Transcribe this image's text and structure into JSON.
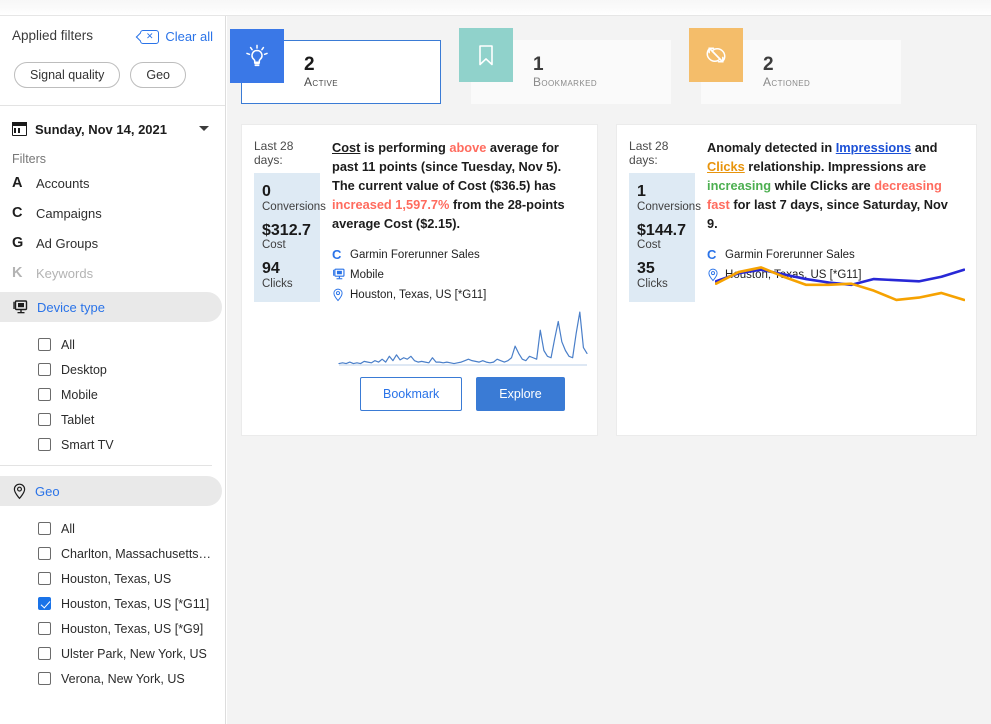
{
  "sidebar": {
    "title": "Applied filters",
    "clear_all": "Clear all",
    "clear_icon": "clear-x-icon",
    "chips": [
      {
        "label": "Signal quality"
      },
      {
        "label": "Geo"
      }
    ],
    "date": {
      "icon": "calendar-icon",
      "value": "Sunday, Nov 14, 2021",
      "caret": "chevron-down-icon"
    },
    "filters_label": "Filters",
    "filters": [
      {
        "letter": "A",
        "label": "Accounts",
        "dim": false
      },
      {
        "letter": "C",
        "label": "Campaigns",
        "dim": false
      },
      {
        "letter": "G",
        "label": "Ad Groups",
        "dim": false
      },
      {
        "letter": "K",
        "label": "Keywords",
        "dim": true
      }
    ],
    "sections": [
      {
        "id": "device-type",
        "icon": "device-monitor-icon",
        "label": "Device type",
        "options": [
          {
            "label": "All",
            "checked": false
          },
          {
            "label": "Desktop",
            "checked": false
          },
          {
            "label": "Mobile",
            "checked": false
          },
          {
            "label": "Tablet",
            "checked": false
          },
          {
            "label": "Smart TV",
            "checked": false
          }
        ]
      },
      {
        "id": "geo",
        "icon": "location-pin-icon",
        "label": "Geo",
        "options": [
          {
            "label": "All",
            "checked": false
          },
          {
            "label": "Charlton, Massachusetts…",
            "checked": false
          },
          {
            "label": "Houston, Texas, US",
            "checked": false
          },
          {
            "label": "Houston, Texas, US [*G11]",
            "checked": true
          },
          {
            "label": "Houston, Texas, US [*G9]",
            "checked": false
          },
          {
            "label": "Ulster Park, New York, US",
            "checked": false
          },
          {
            "label": "Verona, New York, US",
            "checked": false
          }
        ]
      }
    ]
  },
  "status_cards": [
    {
      "id": "active",
      "count": "2",
      "label": "Active",
      "icon": "lightbulb-icon",
      "selected": true,
      "color": "#3a78e7"
    },
    {
      "id": "bookmarked",
      "count": "1",
      "label": "Bookmarked",
      "icon": "bookmark-icon",
      "selected": false,
      "color": "#90d2cb"
    },
    {
      "id": "actioned",
      "count": "2",
      "label": "Actioned",
      "icon": "actioned-arrows-icon",
      "selected": false,
      "color": "#f4bd6a"
    }
  ],
  "insight_cards": [
    {
      "id": "cost-insight",
      "period_label": "Last 28 days:",
      "metrics": [
        {
          "value": "0",
          "label": "Conversions"
        },
        {
          "value": "$312.7",
          "label": "Cost"
        },
        {
          "value": "94",
          "label": "Clicks"
        }
      ],
      "narrative": {
        "segments": [
          {
            "text": "Cost",
            "style": "underline"
          },
          {
            "text": " is performing ",
            "style": "plain"
          },
          {
            "text": "above",
            "style": "red"
          },
          {
            "text": " average for past 11 points (since Tuesday, Nov 5). The current value of Cost ($36.5) has ",
            "style": "plain"
          },
          {
            "text": "increased 1,597.7%",
            "style": "red"
          },
          {
            "text": " from the 28-points average Cost ($2.15).",
            "style": "plain"
          }
        ]
      },
      "meta": [
        {
          "icon": "campaign-c-icon",
          "text": "Garmin Forerunner Sales"
        },
        {
          "icon": "device-monitor-icon",
          "text": "Mobile"
        },
        {
          "icon": "location-pin-icon",
          "text": "Houston, Texas, US [*G11]"
        }
      ],
      "buttons": [
        {
          "id": "bookmark",
          "label": "Bookmark",
          "variant": "ghost"
        },
        {
          "id": "explore",
          "label": "Explore",
          "variant": "primary"
        }
      ]
    },
    {
      "id": "anomaly-insight",
      "period_label": "Last 28 days:",
      "metrics": [
        {
          "value": "1",
          "label": "Conversions"
        },
        {
          "value": "$144.7",
          "label": "Cost"
        },
        {
          "value": "35",
          "label": "Clicks"
        }
      ],
      "narrative": {
        "segments": [
          {
            "text": "Anomaly detected in ",
            "style": "plain"
          },
          {
            "text": "Impressions",
            "style": "blue-underline"
          },
          {
            "text": " and ",
            "style": "plain"
          },
          {
            "text": "Clicks",
            "style": "orange-underline"
          },
          {
            "text": " relationship. Impressions are ",
            "style": "plain"
          },
          {
            "text": "increasing",
            "style": "green"
          },
          {
            "text": " while Clicks are ",
            "style": "plain"
          },
          {
            "text": "decreasing fast",
            "style": "red"
          },
          {
            "text": " for last 7 days, since Saturday, Nov 9.",
            "style": "plain"
          }
        ]
      },
      "meta": [
        {
          "icon": "campaign-c-icon",
          "text": "Garmin Forerunner Sales"
        },
        {
          "icon": "location-pin-icon",
          "text": "Houston, Texas, US [*G11]"
        }
      ],
      "buttons": []
    }
  ],
  "chart_data": [
    {
      "id": "cost-sparkline",
      "type": "line",
      "title": "",
      "xlabel": "",
      "ylabel": "",
      "grid": false,
      "legend": "none",
      "ylim": [
        0,
        40
      ],
      "series": [
        {
          "name": "Cost",
          "color": "#4a7fc9",
          "values": [
            1,
            1.5,
            1,
            2,
            1,
            1.5,
            1,
            2.5,
            2,
            1.5,
            3,
            2,
            4,
            2,
            6,
            3,
            7,
            3.5,
            5,
            4,
            6,
            3,
            2,
            2.5,
            2,
            1.5,
            5,
            2,
            2,
            1.5,
            2,
            1.5,
            1,
            1.5,
            2,
            3,
            4,
            3,
            2.5,
            2,
            3,
            2,
            1.5,
            2,
            4,
            3,
            2,
            3,
            5,
            13,
            8,
            4,
            3,
            6,
            5,
            4,
            24,
            10,
            6,
            5,
            18,
            30,
            16,
            10,
            6,
            5,
            22,
            36.5,
            12,
            8
          ]
        }
      ]
    },
    {
      "id": "impressions-clicks",
      "type": "line",
      "title": "",
      "xlabel": "",
      "ylabel": "",
      "grid": false,
      "legend": "none",
      "ylim": [
        0,
        100
      ],
      "series": [
        {
          "name": "Impressions",
          "color": "#2828d6",
          "values": [
            58,
            72,
            78,
            70,
            62,
            56,
            52,
            62,
            60,
            58,
            66,
            78
          ]
        },
        {
          "name": "Clicks",
          "color": "#f6a201",
          "values": [
            54,
            74,
            82,
            66,
            52,
            52,
            54,
            42,
            26,
            30,
            38,
            26
          ]
        }
      ]
    }
  ]
}
